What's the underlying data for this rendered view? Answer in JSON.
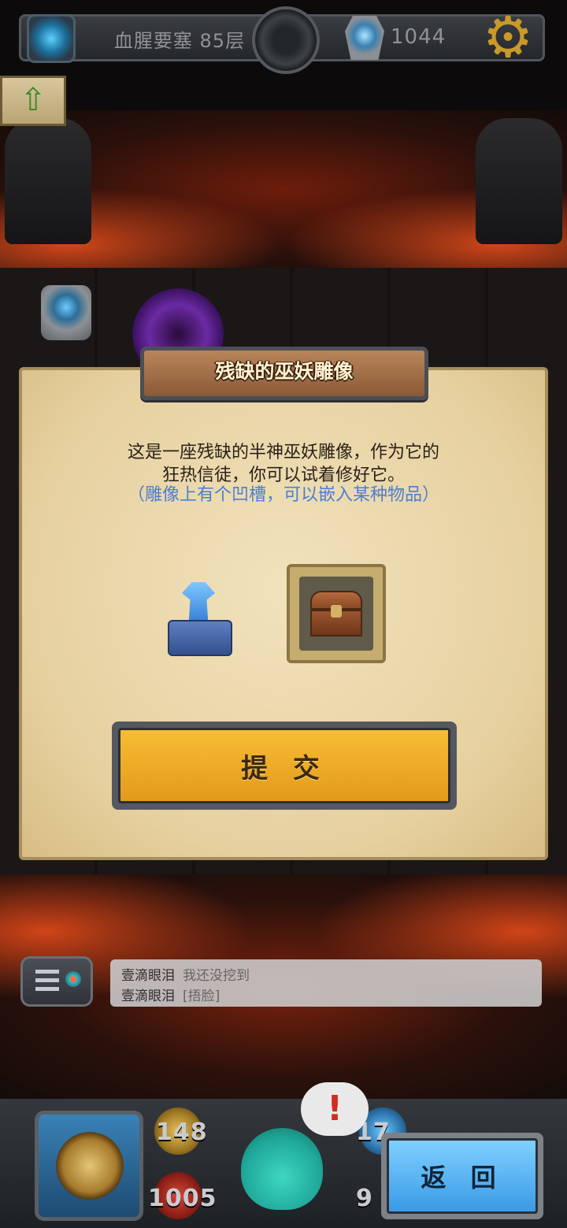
{
  "hud": {
    "floor_label": "血腥要塞 85层",
    "gem_count": "1044",
    "icons": {
      "portal": "portal-icon",
      "bomb": "bomb-icon",
      "gem": "gem-icon",
      "settings": "gear-icon"
    }
  },
  "dialog": {
    "title": "残缺的巫妖雕像",
    "description_line1": "这是一座残缺的半神巫妖雕像，作为它的",
    "description_line2": "狂热信徒，你可以试着修好它。",
    "hint": "（雕像上有个凹槽，可以嵌入某种物品）",
    "submit_label": "提 交",
    "statue_icon": "lich-statue-icon",
    "slot_item_icon": "treasure-chest-icon"
  },
  "chat": {
    "lines": [
      {
        "user": "壹滴眼泪",
        "message": "我还没挖到"
      },
      {
        "user": "壹滴眼泪",
        "message": "[捂脸]"
      }
    ]
  },
  "bottom": {
    "attack": "148",
    "health": "1005",
    "stat_right_top": "17",
    "stat_right_bottom": "9",
    "alert": "!",
    "back_label": "返 回"
  },
  "colors": {
    "submit_button": "#f2b22c",
    "back_button": "#5cb6f4",
    "hint_text": "#4d7fd2",
    "parchment": "#ecd9ad"
  }
}
